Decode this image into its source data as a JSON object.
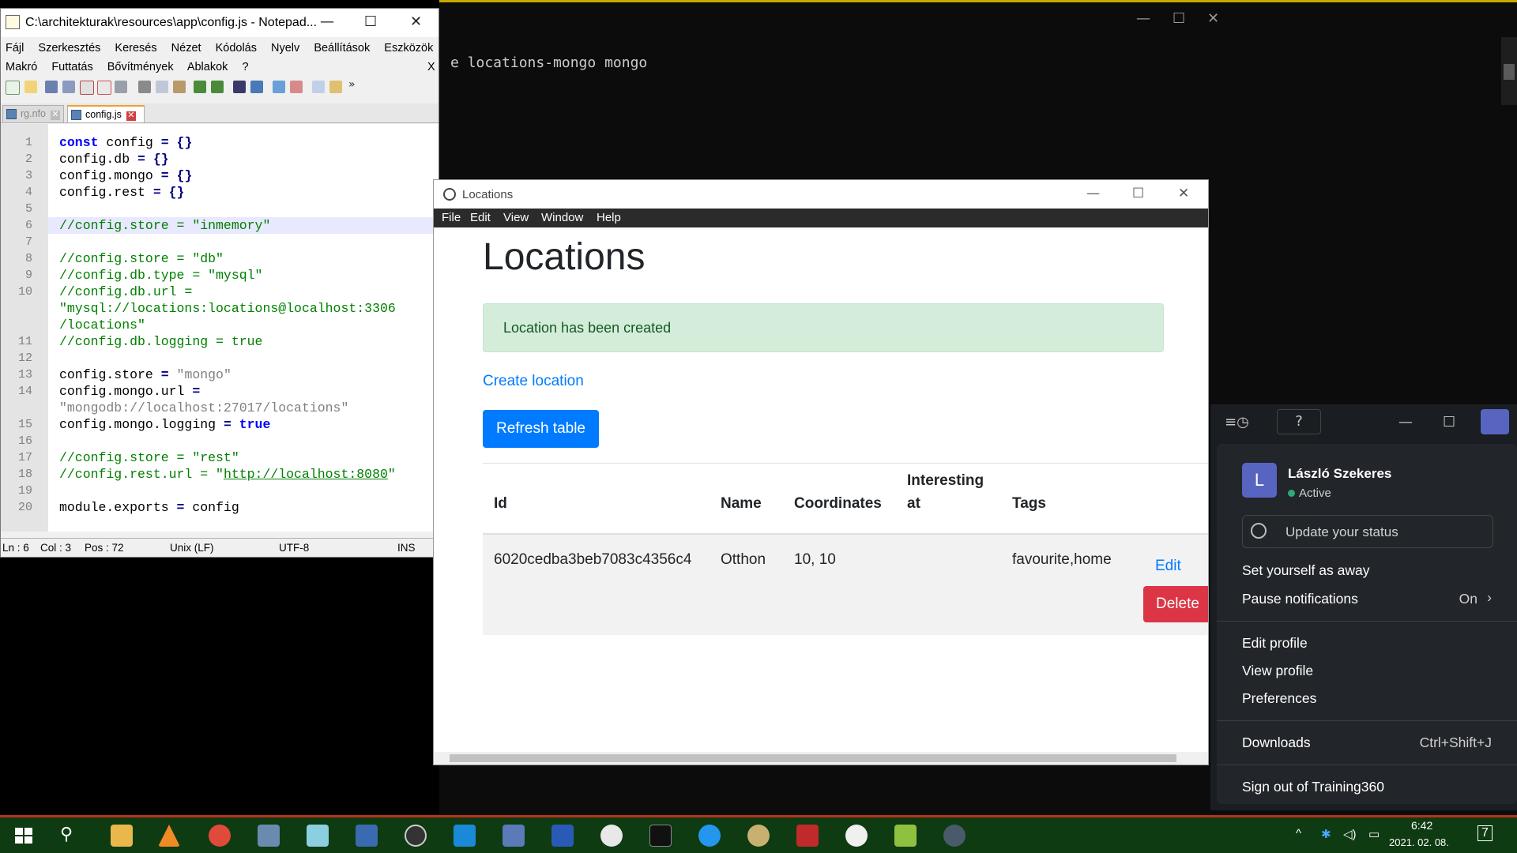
{
  "terminal": {
    "text": "e locations-mongo mongo",
    "controls": {
      "min": "—",
      "max": "☐",
      "close": "✕"
    }
  },
  "notepad": {
    "title": "C:\\architekturak\\resources\\app\\config.js - Notepad...",
    "controls": {
      "min": "—",
      "max": "☐",
      "close": "✕"
    },
    "menu_row1": [
      "Fájl",
      "Szerkesztés",
      "Keresés",
      "Nézet",
      "Kódolás",
      "Nyelv",
      "Beállítások",
      "Eszközök"
    ],
    "menu_row2": [
      "Makró",
      "Futtatás",
      "Bővítmények",
      "Ablakok",
      "?"
    ],
    "menu_close": "X",
    "toolbar_more": "»",
    "tabs": [
      {
        "label": "rg.nfo",
        "active": false
      },
      {
        "label": "config.js",
        "active": true
      }
    ],
    "tab_close": "✕",
    "lines": [
      {
        "n": "1",
        "segs": [
          {
            "t": "const",
            "c": "kw"
          },
          {
            "t": " config ",
            "c": ""
          },
          {
            "t": "=",
            "c": "op"
          },
          {
            "t": " ",
            "c": ""
          },
          {
            "t": "{}",
            "c": "op"
          }
        ]
      },
      {
        "n": "2",
        "segs": [
          {
            "t": "config.db ",
            "c": ""
          },
          {
            "t": "=",
            "c": "op"
          },
          {
            "t": " ",
            "c": ""
          },
          {
            "t": "{}",
            "c": "op"
          }
        ]
      },
      {
        "n": "3",
        "segs": [
          {
            "t": "config.mongo ",
            "c": ""
          },
          {
            "t": "=",
            "c": "op"
          },
          {
            "t": " ",
            "c": ""
          },
          {
            "t": "{}",
            "c": "op"
          }
        ]
      },
      {
        "n": "4",
        "segs": [
          {
            "t": "config.rest ",
            "c": ""
          },
          {
            "t": "=",
            "c": "op"
          },
          {
            "t": " ",
            "c": ""
          },
          {
            "t": "{}",
            "c": "op"
          }
        ]
      },
      {
        "n": "5",
        "segs": []
      },
      {
        "n": "6",
        "segs": [
          {
            "t": "//config.store = \"inmemory\"",
            "c": "cm"
          }
        ]
      },
      {
        "n": "7",
        "segs": []
      },
      {
        "n": "8",
        "segs": [
          {
            "t": "//config.store = \"db\"",
            "c": "cm"
          }
        ]
      },
      {
        "n": "9",
        "segs": [
          {
            "t": "//config.db.type = \"mysql\"",
            "c": "cm"
          }
        ]
      },
      {
        "n": "10",
        "segs": [
          {
            "t": "//config.db.url =",
            "c": "cm"
          }
        ]
      },
      {
        "n": "",
        "segs": [
          {
            "t": "\"mysql://locations:locations@localhost:3306",
            "c": "cm"
          }
        ]
      },
      {
        "n": "",
        "segs": [
          {
            "t": "/locations\"",
            "c": "cm"
          }
        ]
      },
      {
        "n": "11",
        "segs": [
          {
            "t": "//config.db.logging = true",
            "c": "cm"
          }
        ]
      },
      {
        "n": "12",
        "segs": []
      },
      {
        "n": "13",
        "segs": [
          {
            "t": "config.store ",
            "c": ""
          },
          {
            "t": "=",
            "c": "op"
          },
          {
            "t": " \"mongo\"",
            "c": "st"
          }
        ]
      },
      {
        "n": "14",
        "segs": [
          {
            "t": "config.mongo.url ",
            "c": ""
          },
          {
            "t": "=",
            "c": "op"
          }
        ]
      },
      {
        "n": "",
        "segs": [
          {
            "t": "\"mongodb://localhost:27017/locations\"",
            "c": "st"
          }
        ]
      },
      {
        "n": "15",
        "segs": [
          {
            "t": "config.mongo.logging ",
            "c": ""
          },
          {
            "t": "=",
            "c": "op"
          },
          {
            "t": " ",
            "c": ""
          },
          {
            "t": "true",
            "c": "kw"
          }
        ]
      },
      {
        "n": "16",
        "segs": []
      },
      {
        "n": "17",
        "segs": [
          {
            "t": "//config.store = \"rest\"",
            "c": "cm"
          }
        ]
      },
      {
        "n": "18",
        "segs": [
          {
            "t": "//config.rest.url = \"",
            "c": "cm"
          },
          {
            "t": "http://localhost:8080",
            "c": "cm ul"
          },
          {
            "t": "\"",
            "c": "cm"
          }
        ]
      },
      {
        "n": "19",
        "segs": []
      },
      {
        "n": "20",
        "segs": [
          {
            "t": "module.exports ",
            "c": ""
          },
          {
            "t": "=",
            "c": "op"
          },
          {
            "t": " config",
            "c": ""
          }
        ]
      }
    ],
    "status": {
      "ln": "Ln : 6",
      "col": "Col : 3",
      "pos": "Pos : 72",
      "eol": "Unix (LF)",
      "enc": "UTF-8",
      "mode": "INS"
    }
  },
  "locations": {
    "title": "Locations",
    "controls": {
      "min": "—",
      "max": "☐",
      "close": "✕"
    },
    "menu": [
      "File",
      "Edit",
      "View",
      "Window",
      "Help"
    ],
    "heading": "Locations",
    "alert": "Location has been created",
    "create_link": "Create location",
    "refresh_button": "Refresh table",
    "columns": {
      "id": "Id",
      "name": "Name",
      "coordinates": "Coordinates",
      "interesting1": "Interesting",
      "interesting2": "at",
      "tags": "Tags"
    },
    "rows": [
      {
        "id": "6020cedba3beb7083c4356c4",
        "name": "Otthon",
        "coordinates": "10, 10",
        "interesting_at": "",
        "tags": "favourite,home",
        "edit": "Edit",
        "delete": "Delete"
      }
    ]
  },
  "slack": {
    "topbar": {
      "history_icon": "≡◷",
      "help_icon": "?",
      "min": "—",
      "max": "☐"
    },
    "user_initial": "L",
    "user_name": "László Szekeres",
    "presence": "Active",
    "update_status": "Update your status",
    "items": {
      "away": "Set yourself as away",
      "pause": "Pause notifications",
      "pause_value": "On",
      "pause_arrow": "›",
      "edit_profile": "Edit profile",
      "view_profile": "View profile",
      "preferences": "Preferences",
      "downloads": "Downloads",
      "downloads_shortcut": "Ctrl+Shift+J",
      "signout": "Sign out of Training360"
    }
  },
  "taskbar": {
    "time": "6:42",
    "date": "2021. 02. 08.",
    "notification_count": "7",
    "tray_arrow": "^",
    "apps": [
      "windows-start",
      "search",
      "file-explorer",
      "vlc",
      "chrome",
      "calculator",
      "notes",
      "network-app",
      "obs",
      "virtualbox",
      "remote-desktop",
      "powershell",
      "slack",
      "terminal",
      "docker",
      "paint",
      "game-app",
      "inkscape",
      "notepad-plus-plus",
      "electron-app"
    ],
    "colors": {
      "bar": "#0e3b12",
      "accent": "#b8321e"
    }
  }
}
